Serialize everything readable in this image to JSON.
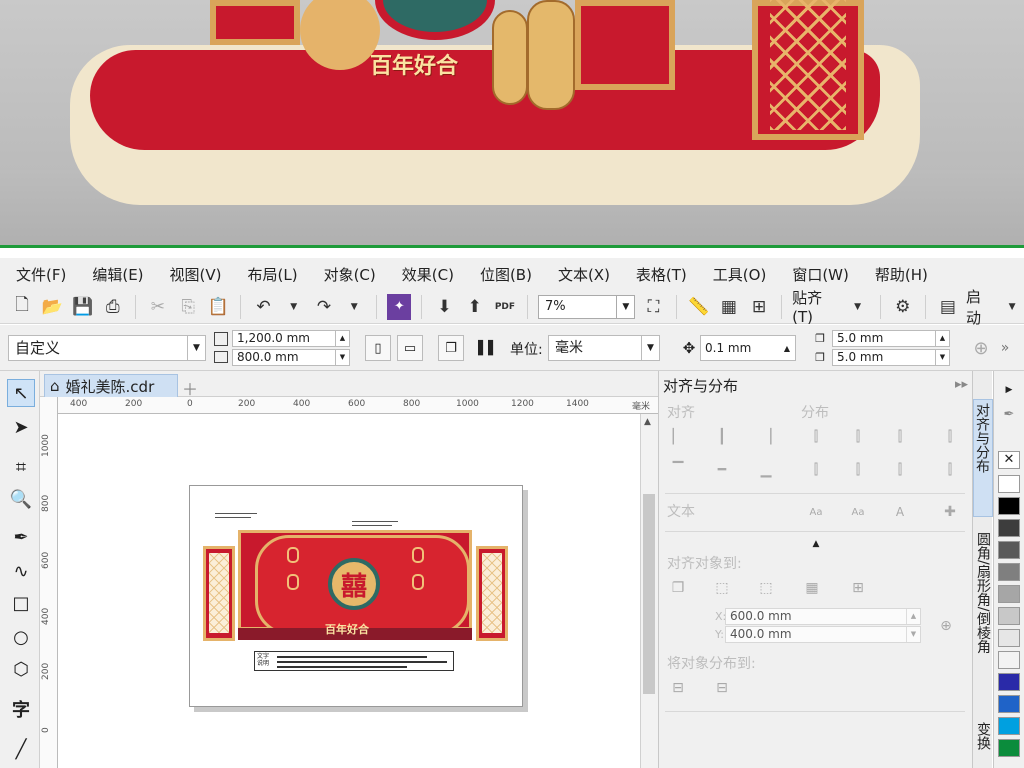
{
  "render_preview": {
    "sign_text": "百年好合"
  },
  "menu": [
    "文件(F)",
    "编辑(E)",
    "视图(V)",
    "布局(L)",
    "对象(C)",
    "效果(C)",
    "位图(B)",
    "文本(X)",
    "表格(T)",
    "工具(O)",
    "窗口(W)",
    "帮助(H)"
  ],
  "toolbar": {
    "zoom": "7%",
    "snap_label": "贴齐(T)",
    "launch_label": "启动",
    "pdf_label": "PDF"
  },
  "property_bar": {
    "page_preset": "自定义",
    "width": "1,200.0 mm",
    "height": "800.0 mm",
    "unit_label": "单位:",
    "unit_value": "毫米",
    "nudge": "0.1 mm",
    "dup_x": "5.0 mm",
    "dup_y": "5.0 mm"
  },
  "document": {
    "tab_name": "婚礼美陈.cdr",
    "ruler_h_labels": [
      "400",
      "200",
      "0",
      "200",
      "400",
      "600",
      "800",
      "1000",
      "1200",
      "1400"
    ],
    "ruler_h_unit": "毫米",
    "ruler_v_labels": [
      "1000",
      "800",
      "600",
      "400",
      "200",
      "0"
    ],
    "preview_title": "百年好合",
    "note_label": "文字说明"
  },
  "docker": {
    "title": "对齐与分布",
    "align_label": "对齐",
    "distribute_label": "分布",
    "text_label": "文本",
    "align_to_label": "对齐对象到:",
    "x_value": "600.0 mm",
    "y_value": "400.0 mm",
    "x_label": "X:",
    "y_label": "Y:",
    "distribute_to_label": "将对象分布到:"
  },
  "vertical_tabs": [
    "对齐与分布",
    "圆角/扇形角/倒棱角",
    "变换"
  ],
  "palette_colors": [
    "#ffffff",
    "#000000",
    "#3d3d3d",
    "#595959",
    "#7f7f7f",
    "#a6a6a6",
    "#c8c8c8",
    "#e6e6e6",
    "#f2f2f2",
    "#2a2aa8",
    "#1f63c8",
    "#00a0e0",
    "#0b8c3c"
  ]
}
